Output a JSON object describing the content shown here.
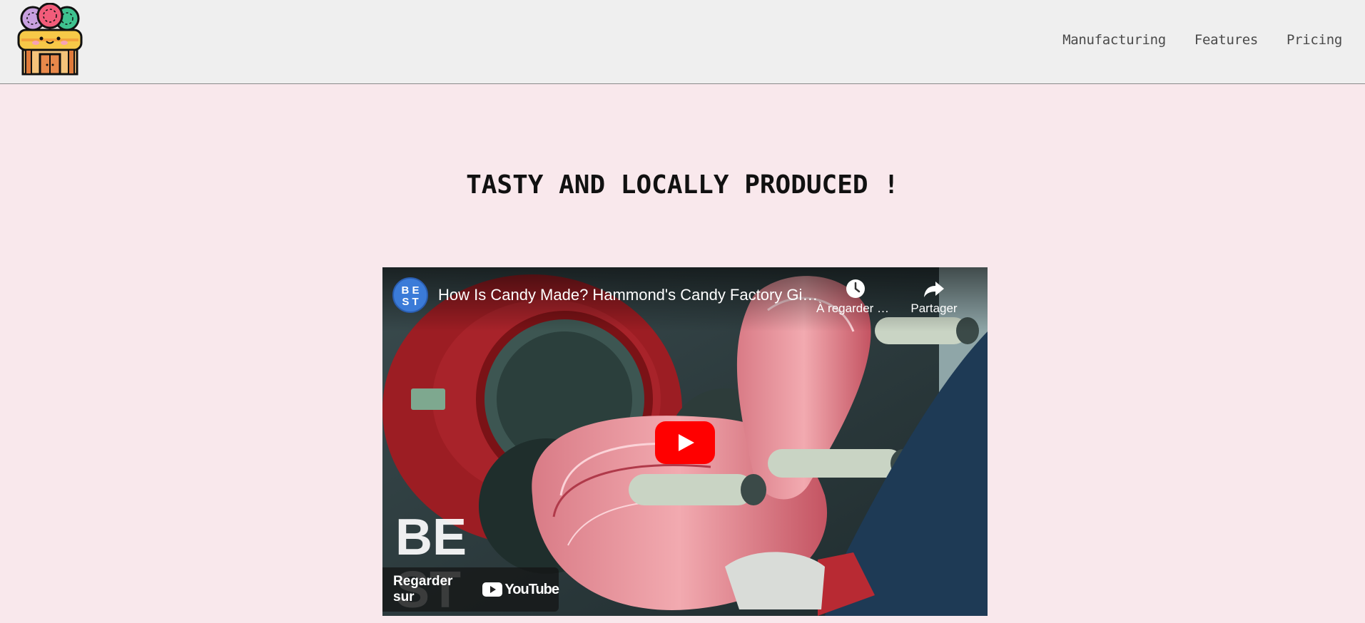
{
  "header": {
    "logo_name": "candy-shop-logo",
    "nav": [
      {
        "label": "Manufacturing"
      },
      {
        "label": "Features"
      },
      {
        "label": "Pricing"
      }
    ]
  },
  "hero": {
    "title": "TASTY AND LOCALLY PRODUCED !"
  },
  "video": {
    "channel_avatar_text": "BE ST",
    "title": "How Is Candy Made? Hammond's Candy Factory Gives Us a Tour",
    "actions": [
      {
        "label": "À regarder plus tard",
        "icon": "clock-icon"
      },
      {
        "label": "Partager",
        "icon": "share-icon"
      }
    ],
    "watch_on_label": "Regarder sur",
    "youtube_wordmark": "YouTube",
    "play_color": "#ff0000"
  }
}
